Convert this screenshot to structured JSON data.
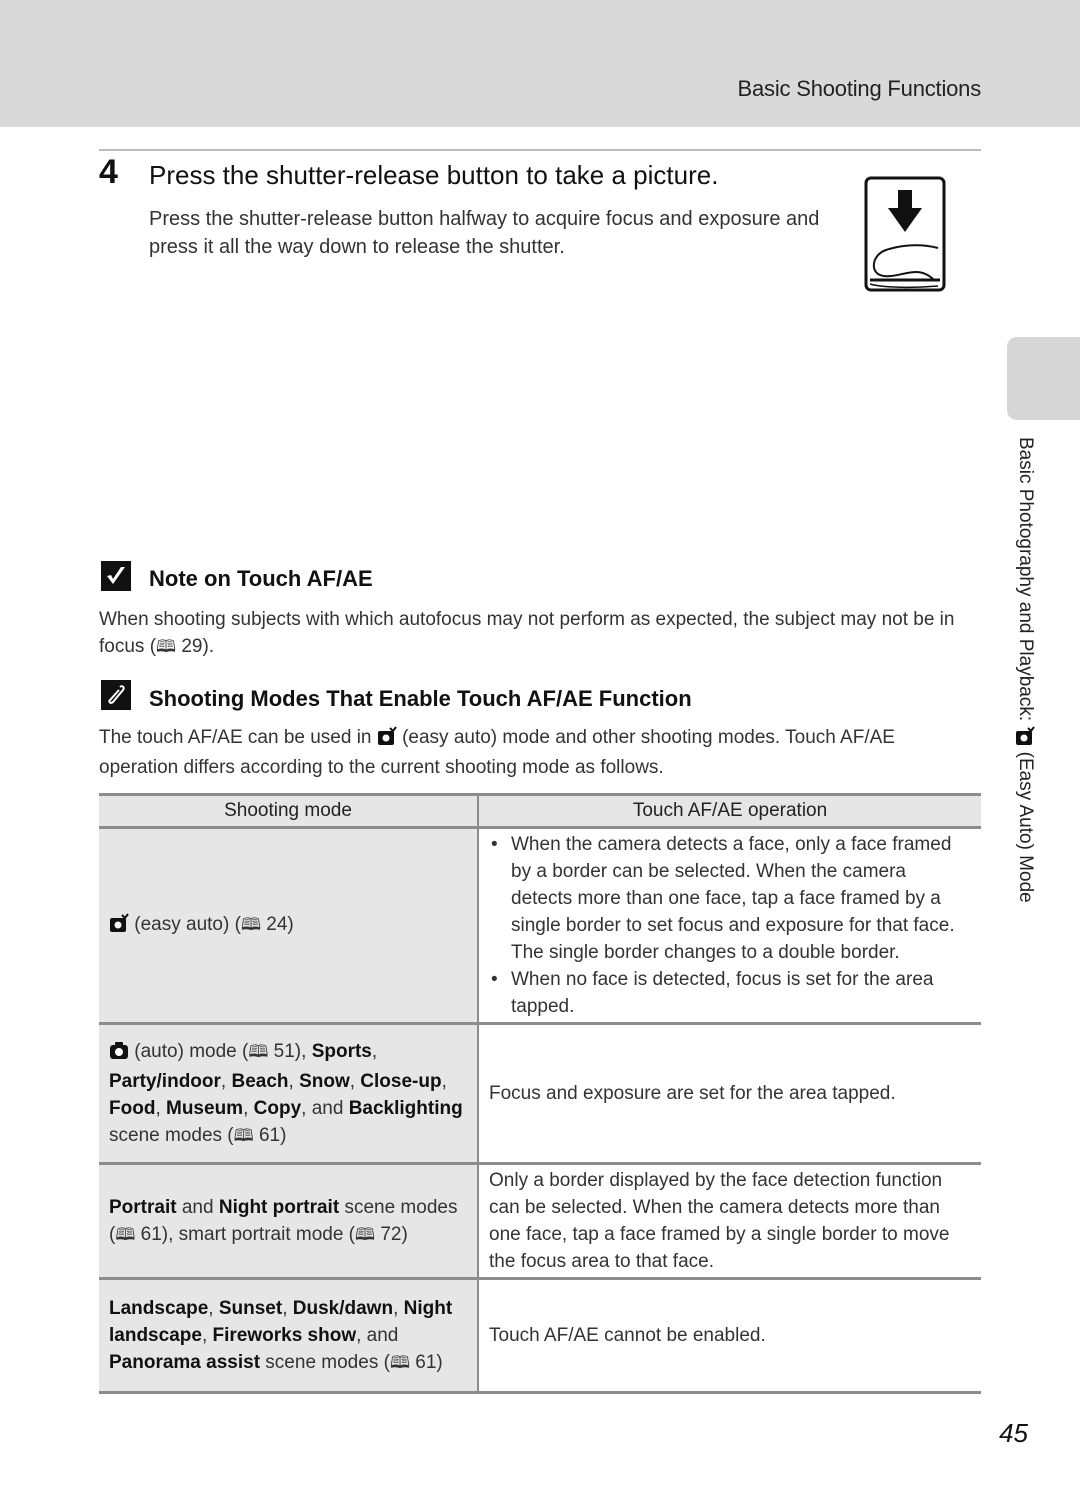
{
  "header": {
    "section_title": "Basic Shooting Functions"
  },
  "step": {
    "number": "4",
    "title": "Press the shutter-release button to take a picture.",
    "body": "Press the shutter-release button halfway to acquire focus and exposure and press it all the way down to release the shutter."
  },
  "note": {
    "icon": "check-icon",
    "title": "Note on Touch AF/AE",
    "body_prefix": "When shooting subjects with which autofocus may not perform as expected, the subject may not be in focus (",
    "ref_icon": "book-icon",
    "ref_page": " 29",
    "body_suffix": ")."
  },
  "tip": {
    "icon": "paperclip-icon",
    "title": "Shooting Modes That Enable Touch AF/AE Function",
    "body_prefix": "The touch AF/AE can be used in ",
    "mode_icon": "easy-auto-camera-icon",
    "body_suffix": " (easy auto) mode and other shooting modes. Touch AF/AE operation differs according to the current shooting mode as follows."
  },
  "table": {
    "headers": [
      "Shooting mode",
      "Touch AF/AE operation"
    ],
    "rows": [
      {
        "mode": {
          "icon": "easy-auto-camera-icon",
          "text": " (easy auto) (",
          "ref": " 24",
          "close": ")"
        },
        "operation_bullets": [
          "When the camera detects a face, only a face framed by a border can be selected. When the camera detects more than one face, tap a face framed by a single border to set focus and exposure for that face. The single border changes to a double border.",
          "When no face is detected, focus is set for the area tapped."
        ]
      },
      {
        "mode": {
          "icon": "auto-camera-icon",
          "t1": " (auto) mode (",
          "ref1": " 51",
          "t2": "), ",
          "b1": "Sports",
          "s1": ", ",
          "b2": "Party/indoor",
          "s2": ", ",
          "b3": "Beach",
          "s3": ", ",
          "b4": "Snow",
          "s4": ", ",
          "b5": "Close-up",
          "s5": ", ",
          "b6": "Food",
          "s6": ", ",
          "b7": "Museum",
          "s7": ", ",
          "b8": "Copy",
          "s8": ", and ",
          "b9": "Backlighting",
          "t3": " scene modes (",
          "ref2": " 61",
          "close": ")"
        },
        "operation": "Focus and exposure are set for the area tapped."
      },
      {
        "mode": {
          "b1": "Portrait",
          "t1": " and ",
          "b2": "Night portrait",
          "t2": " scene modes (",
          "ref1": " 61",
          "t3": "), smart portrait mode (",
          "ref2": " 72",
          "close": ")"
        },
        "operation": "Only a border displayed by the face detection function can be selected. When the camera detects more than one face, tap a face framed by a single border to move the focus area to that face."
      },
      {
        "mode": {
          "b1": "Landscape",
          "s1": ", ",
          "b2": "Sunset",
          "s2": ", ",
          "b3": "Dusk/dawn",
          "s3": ", ",
          "b4": "Night landscape",
          "s4": ", ",
          "b5": "Fireworks show",
          "s5": ", and ",
          "b6": "Panorama assist",
          "t1": " scene modes (",
          "ref1": " 61",
          "close": ")"
        },
        "operation": "Touch AF/AE cannot be enabled."
      }
    ]
  },
  "side_tab": {
    "label_prefix": "Basic Photography and Playback: ",
    "label_icon": "easy-auto-camera-icon",
    "label_suffix": " (Easy Auto) Mode"
  },
  "page_number": "45",
  "glyphs": {
    "book": "🕮"
  }
}
